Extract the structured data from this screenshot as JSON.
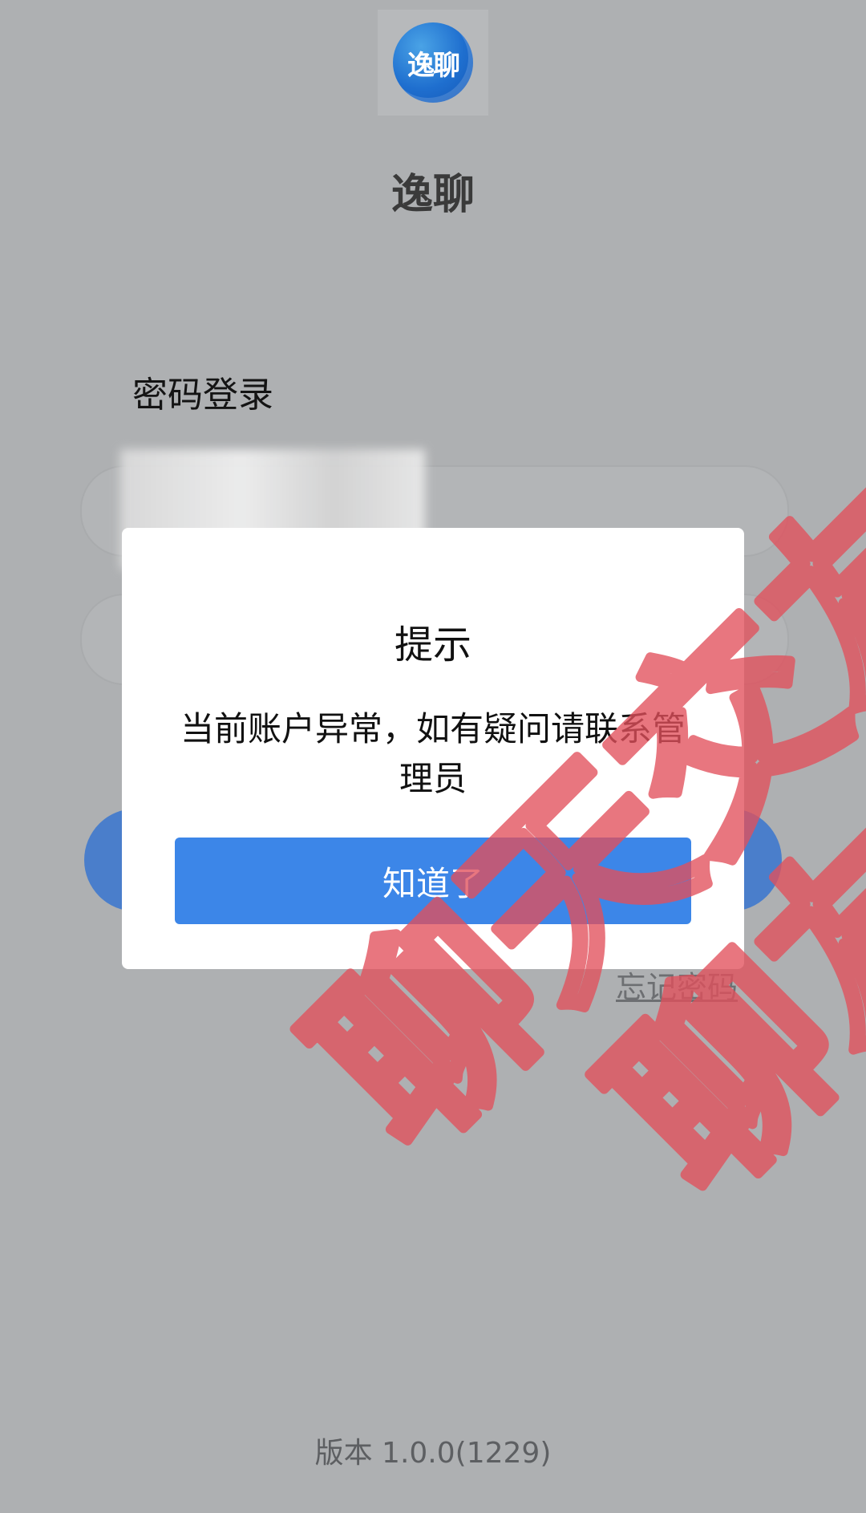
{
  "app": {
    "logo_text": "逸聊",
    "title": "逸聊"
  },
  "login": {
    "title": "密码登录",
    "forgot_password": "忘记密码",
    "version": "版本 1.0.0(1229)"
  },
  "dialog": {
    "title": "提示",
    "message": "当前账户异常，如有疑问请联系管理员",
    "button": "知道了"
  },
  "watermark": {
    "text_1": "聊天交友",
    "text_2": "聊友骗局"
  },
  "colors": {
    "overlay_bg": "#aeb0b2",
    "primary_button": "#3c86e8",
    "login_button_dim": "#4a7ecb",
    "watermark": "#e2505c"
  }
}
